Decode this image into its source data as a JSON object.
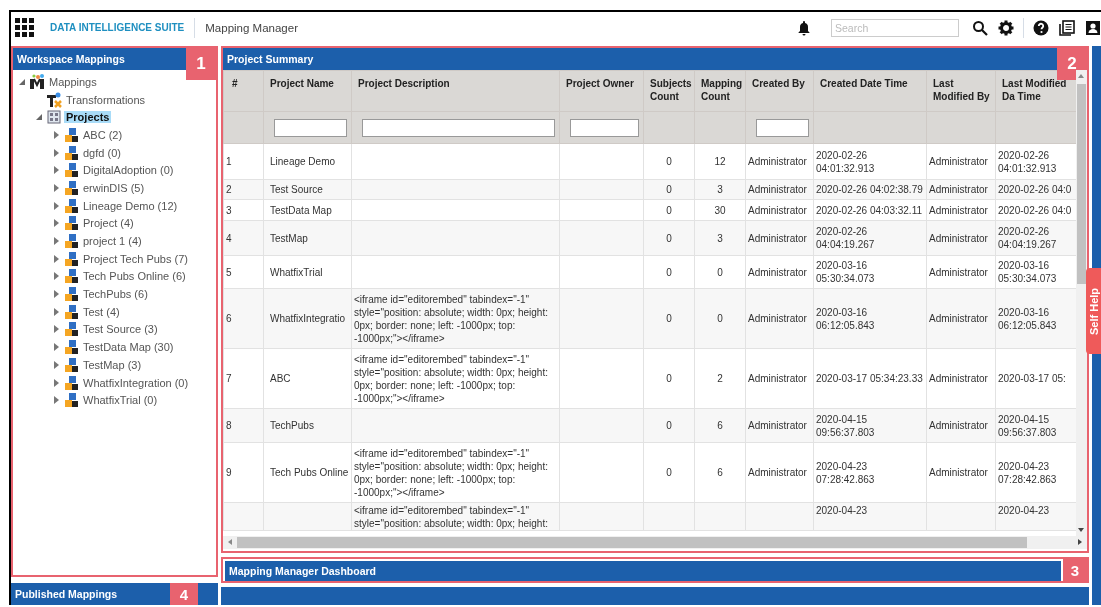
{
  "header": {
    "suite_name": "DATA INTELLIGENCE SUITE",
    "module": "Mapping Manager",
    "search": {
      "placeholder": "Search"
    }
  },
  "workspace_panel": {
    "title": "Workspace Mappings",
    "badge": "1",
    "tree": {
      "label": "Mappings",
      "kind": "root",
      "expanded": true,
      "selected": false,
      "children": [
        {
          "label": "Transformations",
          "kind": "transformations",
          "selected": false
        },
        {
          "label": "Projects",
          "kind": "folder",
          "expanded": true,
          "selected": true,
          "children": [
            {
              "label": "ABC (2)",
              "kind": "project",
              "expanded": false,
              "selected": false
            },
            {
              "label": "dgfd (0)",
              "kind": "project",
              "expanded": false,
              "selected": false
            },
            {
              "label": "DigitalAdoption (0)",
              "kind": "project",
              "expanded": false,
              "selected": false
            },
            {
              "label": "erwinDIS (5)",
              "kind": "project",
              "expanded": false,
              "selected": false
            },
            {
              "label": "Lineage Demo (12)",
              "kind": "project",
              "expanded": false,
              "selected": false
            },
            {
              "label": "Project (4)",
              "kind": "project",
              "expanded": false,
              "selected": false
            },
            {
              "label": "project 1 (4)",
              "kind": "project",
              "expanded": false,
              "selected": false
            },
            {
              "label": "Project Tech Pubs (7)",
              "kind": "project",
              "expanded": false,
              "selected": false
            },
            {
              "label": "Tech Pubs Online (6)",
              "kind": "project",
              "expanded": false,
              "selected": false
            },
            {
              "label": "TechPubs (6)",
              "kind": "project",
              "expanded": false,
              "selected": false
            },
            {
              "label": "Test (4)",
              "kind": "project",
              "expanded": false,
              "selected": false
            },
            {
              "label": "Test Source (3)",
              "kind": "project",
              "expanded": false,
              "selected": false
            },
            {
              "label": "TestData Map (30)",
              "kind": "project",
              "expanded": false,
              "selected": false
            },
            {
              "label": "TestMap (3)",
              "kind": "project",
              "expanded": false,
              "selected": false
            },
            {
              "label": "WhatfixIntegration (0)",
              "kind": "project",
              "expanded": false,
              "selected": false
            },
            {
              "label": "WhatfixTrial (0)",
              "kind": "project",
              "expanded": false,
              "selected": false
            }
          ]
        }
      ]
    }
  },
  "published_panel": {
    "title": "Published Mappings",
    "badge": "4"
  },
  "project_summary": {
    "title": "Project Summary",
    "badge": "2",
    "columns": [
      {
        "label": "#",
        "filter": false
      },
      {
        "label": "Project Name",
        "filter": true
      },
      {
        "label": "Project Description",
        "filter": true
      },
      {
        "label": "Project Owner",
        "filter": true
      },
      {
        "label": "Subjects Count",
        "filter": false
      },
      {
        "label": "Mapping Count",
        "filter": false
      },
      {
        "label": "Created By",
        "filter": true
      },
      {
        "label": "Created Date Time",
        "filter": false
      },
      {
        "label": "Last Modified By",
        "filter": false
      },
      {
        "label": "Last Modified Da Time",
        "filter": false
      }
    ],
    "rows": [
      {
        "cells": [
          "1",
          "Lineage Demo",
          null,
          null,
          "0",
          "12",
          "Administrator",
          "2020-02-26 04:01:32.913",
          "Administrator",
          "2020-02-26 04:01:32.913"
        ]
      },
      {
        "cells": [
          "2",
          "Test Source",
          null,
          null,
          "0",
          "3",
          "Administrator",
          "2020-02-26 04:02:38.79",
          "Administrator",
          "2020-02-26 04:0"
        ]
      },
      {
        "cells": [
          "3",
          "TestData Map",
          null,
          null,
          "0",
          "30",
          "Administrator",
          "2020-02-26 04:03:32.11",
          "Administrator",
          "2020-02-26 04:0"
        ]
      },
      {
        "cells": [
          "4",
          "TestMap",
          null,
          null,
          "0",
          "3",
          "Administrator",
          "2020-02-26 04:04:19.267",
          "Administrator",
          "2020-02-26 04:04:19.267"
        ]
      },
      {
        "cells": [
          "5",
          "WhatfixTrial",
          null,
          null,
          "0",
          "0",
          "Administrator",
          "2020-03-16 05:30:34.073",
          "Administrator",
          "2020-03-16 05:30:34.073"
        ]
      },
      {
        "cells": [
          "6",
          "WhatfixIntegratio",
          "<iframe id=\"editorembed\" tabindex=\"-1\" style=\"position: absolute; width: 0px; height: 0px; border: none; left: -1000px; top: -1000px;\"></iframe>",
          null,
          "0",
          "0",
          "Administrator",
          "2020-03-16 06:12:05.843",
          "Administrator",
          "2020-03-16 06:12:05.843"
        ]
      },
      {
        "cells": [
          "7",
          "ABC",
          "<iframe id=\"editorembed\" tabindex=\"-1\" style=\"position: absolute; width: 0px; height: 0px; border: none; left: -1000px; top: -1000px;\"></iframe>",
          null,
          "0",
          "2",
          "Administrator",
          "2020-03-17 05:34:23.33",
          "Administrator",
          "2020-03-17 05:"
        ]
      },
      {
        "cells": [
          "8",
          "TechPubs",
          null,
          null,
          "0",
          "6",
          "Administrator",
          "2020-04-15 09:56:37.803",
          "Administrator",
          "2020-04-15 09:56:37.803"
        ]
      },
      {
        "cells": [
          "9",
          "Tech Pubs Online",
          "<iframe id=\"editorembed\" tabindex=\"-1\" style=\"position: absolute; width: 0px; height: 0px; border: none; left: -1000px; top: -1000px;\"></iframe>",
          null,
          "0",
          "6",
          "Administrator",
          "2020-04-23 07:28:42.863",
          "Administrator",
          "2020-04-23 07:28:42.863"
        ]
      },
      {
        "cells": [
          null,
          null,
          "<iframe id=\"editorembed\" tabindex=\"-1\" style=\"position: absolute; width: 0px; height:",
          null,
          null,
          null,
          null,
          "2020-04-23",
          null,
          "2020-04-23"
        ]
      }
    ]
  },
  "dashboard_panel": {
    "title": "Mapping Manager Dashboard",
    "badge": "3"
  },
  "self_help": "Self Help"
}
